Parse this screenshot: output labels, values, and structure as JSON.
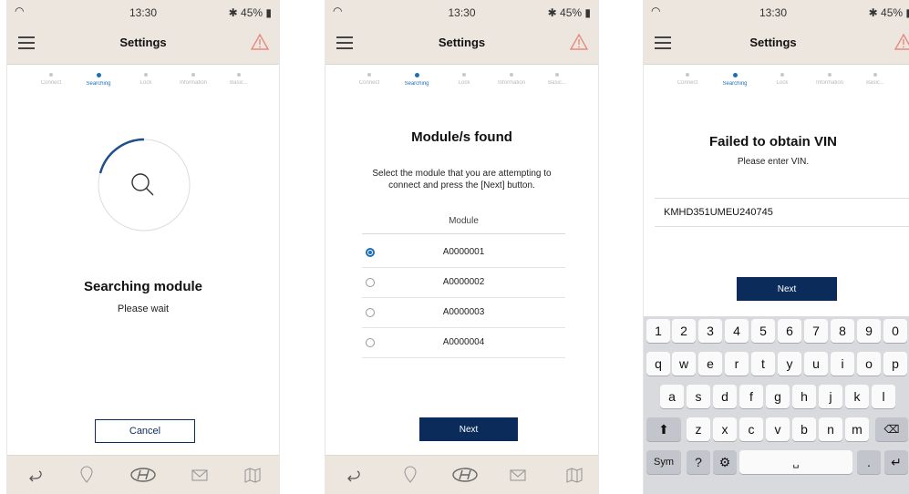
{
  "status": {
    "time": "13:30",
    "battery": "45%"
  },
  "topbar": {
    "title": "Settings"
  },
  "steps": [
    "Connect",
    "Searching",
    "Lock",
    "Information",
    "Basic..."
  ],
  "screen1": {
    "heading": "Searching module",
    "subtext": "Please wait",
    "cancel_label": "Cancel"
  },
  "screen2": {
    "heading": "Module/s found",
    "instruction": "Select the module that you are attempting to connect and press the [Next] button.",
    "column_header": "Module",
    "modules": [
      "A0000001",
      "A0000002",
      "A0000003",
      "A0000004"
    ],
    "selected_index": 0,
    "next_label": "Next"
  },
  "screen3": {
    "heading": "Failed to obtain VIN",
    "subtext": "Please enter VIN.",
    "vin_value": "KMHD351UMEU240745",
    "next_label": "Next",
    "keyboard": {
      "row1": [
        "1",
        "2",
        "3",
        "4",
        "5",
        "6",
        "7",
        "8",
        "9",
        "0"
      ],
      "row2": [
        "q",
        "w",
        "e",
        "r",
        "t",
        "y",
        "u",
        "i",
        "o",
        "p"
      ],
      "row3": [
        "a",
        "s",
        "d",
        "f",
        "g",
        "h",
        "j",
        "k",
        "l"
      ],
      "row4": [
        "z",
        "x",
        "c",
        "v",
        "b",
        "n",
        "m"
      ],
      "sym_label": "Sym",
      "question_key": "?",
      "period_key": "."
    }
  },
  "bottom_icons": [
    "back-arrow-icon",
    "location-pin-icon",
    "hyundai-logo-icon",
    "mail-icon",
    "map-icon"
  ],
  "colors": {
    "bar_bg": "#ece6de",
    "accent_blue": "#1f6fb8",
    "navy": "#0b2c5a",
    "warning": "#e58a80"
  }
}
